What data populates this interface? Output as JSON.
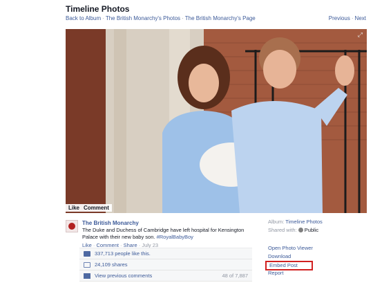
{
  "header": {
    "title": "Timeline Photos",
    "breadcrumbs": [
      "Back to Album",
      "The British Monarchy's Photos",
      "The British Monarchy's Page"
    ],
    "pager": [
      "Previous",
      "Next"
    ]
  },
  "photo": {
    "actions": [
      "Like",
      "Comment"
    ]
  },
  "post": {
    "page_name": "The British Monarchy",
    "caption": "The Duke and Duchess of Cambridge have left hospital for Kensington Palace with their new baby son. ",
    "hashtag": "#RoyalBabyBoy",
    "actions": [
      "Like",
      "Comment",
      "Share"
    ],
    "date": "July 23"
  },
  "ufi": {
    "likes": "337,713 people like this.",
    "shares": "24,109 shares",
    "view_comments": "View previous comments",
    "comment_count": "48 of 7,887"
  },
  "sidebar": {
    "album_label": "Album:",
    "album_value": "Timeline Photos",
    "shared_label": "Shared with:",
    "shared_value": "Public",
    "links": {
      "open_viewer": "Open Photo Viewer",
      "download": "Download",
      "embed": "Embed Post",
      "report": "Report"
    }
  },
  "colors": {
    "link": "#3b5998",
    "muted": "#9197a3",
    "highlight": "#d12020"
  }
}
